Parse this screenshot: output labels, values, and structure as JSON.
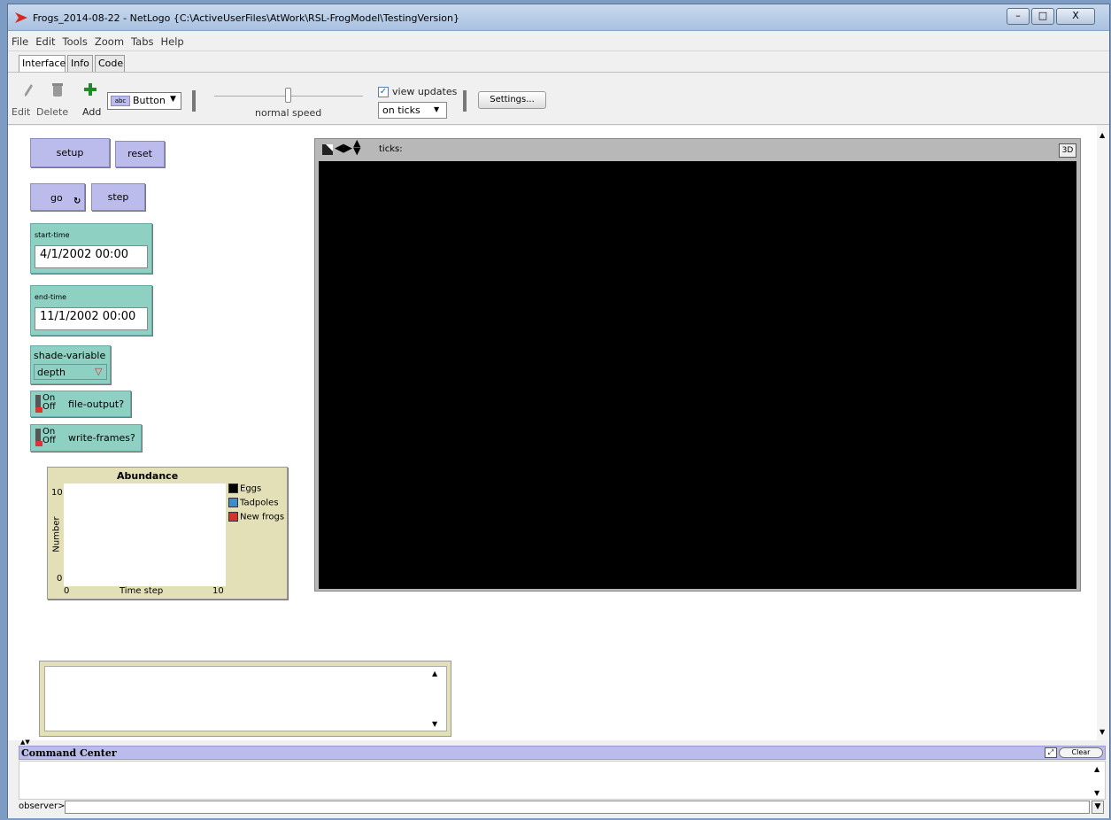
{
  "window": {
    "title": "Frogs_2014-08-22 - NetLogo {C:\\ActiveUserFiles\\AtWork\\RSL-FrogModel\\TestingVersion}",
    "minimize": "–",
    "maximize": "□",
    "close": "X"
  },
  "menu": [
    "File",
    "Edit",
    "Tools",
    "Zoom",
    "Tabs",
    "Help"
  ],
  "tabs": [
    "Interface",
    "Info",
    "Code"
  ],
  "toolbar": {
    "edit": "Edit",
    "delete": "Delete",
    "add": "Add",
    "widget_type": "Button",
    "widget_abc": "abc",
    "speed_label": "normal speed",
    "view_updates": "view updates",
    "update_mode": "on ticks",
    "settings": "Settings..."
  },
  "widgets": {
    "setup": "setup",
    "reset": "reset",
    "go": "go",
    "step": "step",
    "start_time_label": "start-time",
    "start_time_value": "4/1/2002 00:00",
    "end_time_label": "end-time",
    "end_time_value": "11/1/2002 00:00",
    "shade_label": "shade-variable",
    "shade_value": "depth",
    "file_output": "file-output?",
    "write_frames": "write-frames?",
    "on": "On",
    "off": "Off"
  },
  "plot": {
    "title": "Abundance",
    "ylabel": "Number",
    "xlabel": "Time step",
    "ymin": "0",
    "ymax": "10",
    "xmin": "0",
    "xmax": "10",
    "legend": [
      {
        "name": "Eggs",
        "color": "#000000"
      },
      {
        "name": "Tadpoles",
        "color": "#3a8fc9"
      },
      {
        "name": "New frogs",
        "color": "#d9302a"
      }
    ]
  },
  "view": {
    "ticks_label": "ticks:",
    "three_d": "3D"
  },
  "command_center": {
    "title": "Command Center",
    "clear": "Clear",
    "prompt": "observer>"
  }
}
